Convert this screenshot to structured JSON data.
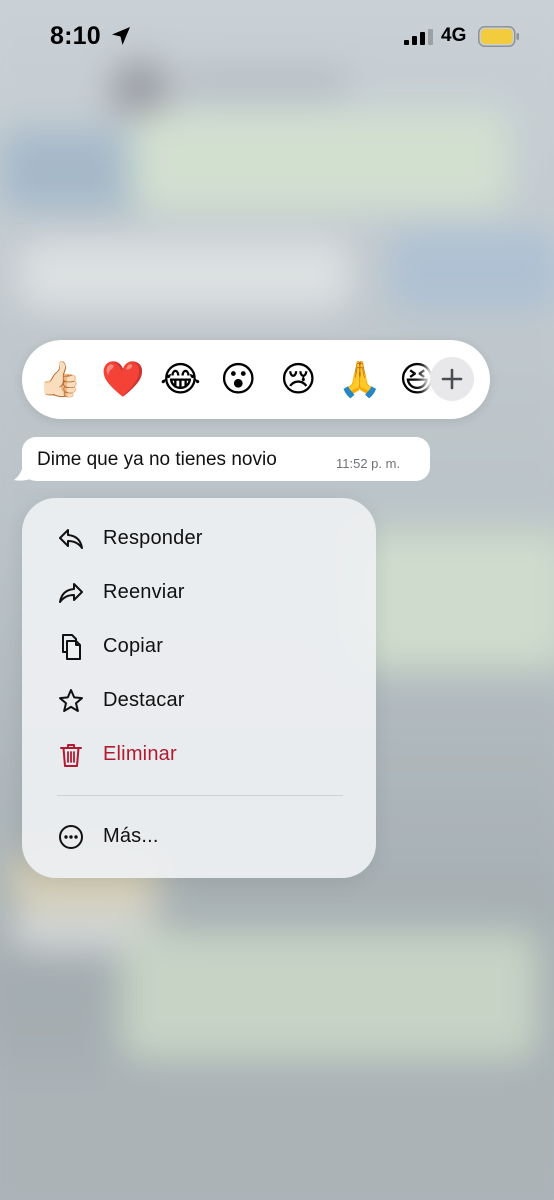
{
  "status_bar": {
    "time": "8:10",
    "network": "4G",
    "location_icon": "location-arrow-icon",
    "signal_icon": "cellular-signal-icon",
    "battery_icon": "battery-icon",
    "battery_color": "#f2cc3c"
  },
  "reactions": {
    "emojis": [
      "👍🏻",
      "❤️",
      "😂",
      "😮",
      "😢",
      "🙏",
      "😆"
    ],
    "more_icon": "plus-icon"
  },
  "message": {
    "text": "Dime que ya no tienes novio",
    "time": "11:52 p. m."
  },
  "menu": {
    "items": [
      {
        "label": "Responder",
        "icon": "reply-icon"
      },
      {
        "label": "Reenviar",
        "icon": "forward-icon"
      },
      {
        "label": "Copiar",
        "icon": "copy-icon"
      },
      {
        "label": "Destacar",
        "icon": "star-icon"
      },
      {
        "label": "Eliminar",
        "icon": "trash-icon",
        "color": "#b21a32"
      },
      {
        "label": "Más...",
        "icon": "more-circle-icon"
      }
    ]
  }
}
